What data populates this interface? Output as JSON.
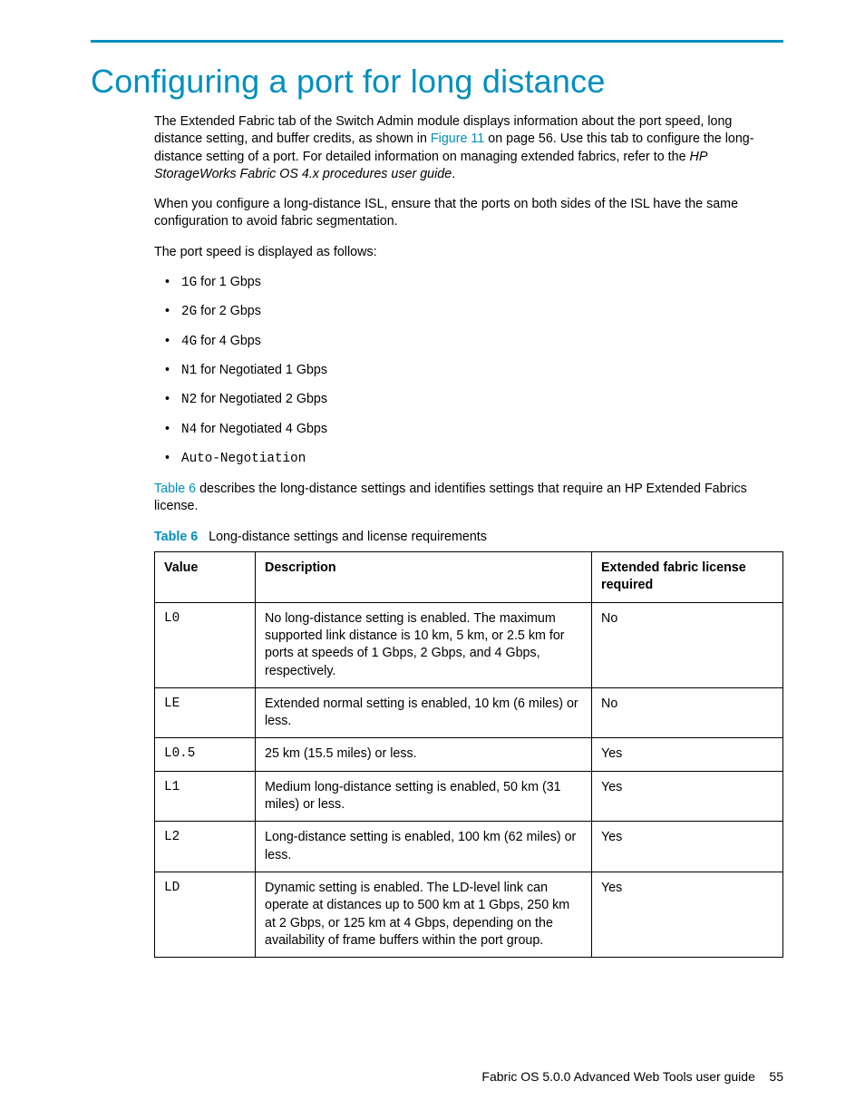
{
  "heading": "Configuring a port for long distance",
  "intro": {
    "p1a": "The Extended Fabric tab of the Switch Admin module displays information about the port speed, long distance setting, and buffer credits, as shown in ",
    "figref": "Figure 11",
    "p1b": " on page 56. Use this tab to configure the long-distance setting of a port. For detailed information on managing extended fabrics, refer to the ",
    "doctitle": "HP StorageWorks Fabric OS 4.x procedures user guide",
    "p1c": ".",
    "p2": "When you configure a long-distance ISL, ensure that the ports on both sides of the ISL have the same configuration to avoid fabric segmentation.",
    "p3": "The port speed is displayed as follows:"
  },
  "speeds": [
    {
      "code": "1G",
      "text": " for 1 Gbps"
    },
    {
      "code": "2G",
      "text": " for 2 Gbps"
    },
    {
      "code": "4G",
      "text": " for 4 Gbps"
    },
    {
      "code": "N1",
      "text": " for Negotiated 1 Gbps"
    },
    {
      "code": "N2",
      "text": " for Negotiated 2 Gbps"
    },
    {
      "code": "N4",
      "text": " for Negotiated 4 Gbps"
    },
    {
      "code": "Auto-Negotiation",
      "text": ""
    }
  ],
  "table_intro": {
    "a": "",
    "link": "Table 6",
    "b": " describes the long-distance settings and identifies settings that require an HP Extended Fabrics license."
  },
  "caption": {
    "label": "Table 6",
    "text": "Long-distance settings and license requirements"
  },
  "table": {
    "headers": {
      "c1": "Value",
      "c2": "Description",
      "c3": "Extended fabric license required"
    },
    "rows": [
      {
        "value": "L0",
        "desc": "No long-distance setting is enabled. The maximum supported link distance is 10 km, 5 km, or 2.5 km for ports at speeds of 1 Gbps, 2 Gbps, and 4 Gbps, respectively.",
        "lic": "No"
      },
      {
        "value": "LE",
        "desc": "Extended normal setting is enabled, 10 km (6 miles) or less.",
        "lic": "No"
      },
      {
        "value": "L0.5",
        "desc": "25 km (15.5 miles) or less.",
        "lic": "Yes"
      },
      {
        "value": "L1",
        "desc": "Medium long-distance setting is enabled, 50 km (31 miles) or less.",
        "lic": "Yes"
      },
      {
        "value": "L2",
        "desc": "Long-distance setting is enabled, 100 km (62 miles) or less.",
        "lic": "Yes"
      },
      {
        "value": "LD",
        "desc": "Dynamic setting is enabled. The LD-level link can operate at distances up to 500 km at 1 Gbps, 250 km at 2 Gbps, or 125 km at 4 Gbps, depending on the availability of frame buffers within the port group.",
        "lic": "Yes"
      }
    ]
  },
  "footer": {
    "doc": "Fabric OS 5.0.0 Advanced Web Tools user guide",
    "page": "55"
  }
}
